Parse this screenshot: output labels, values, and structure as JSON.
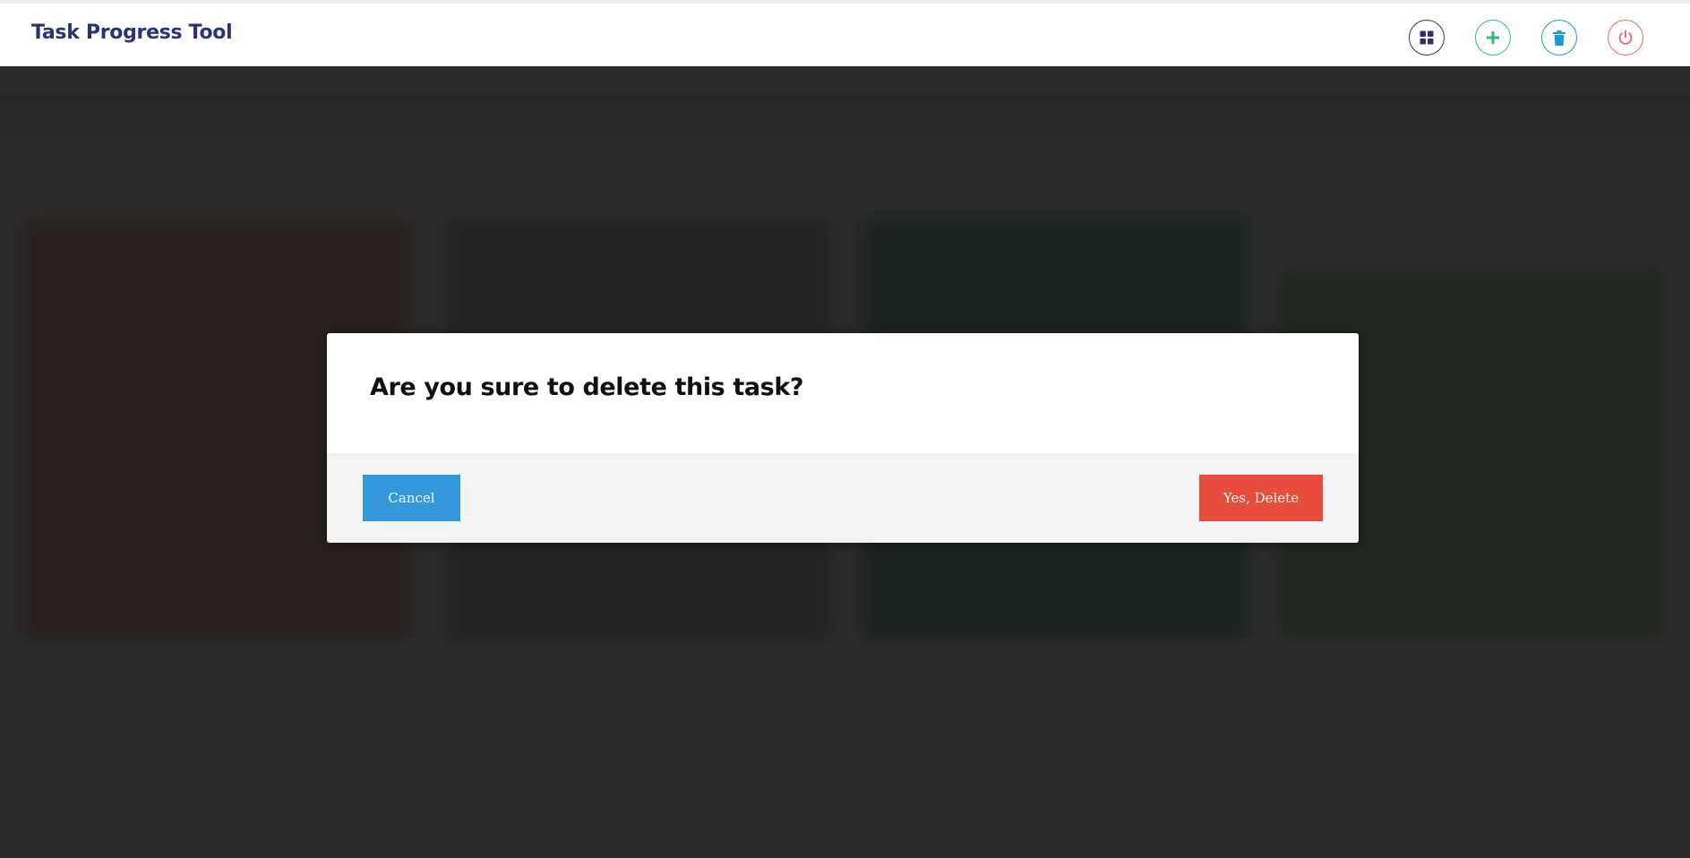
{
  "header": {
    "title": "Task Progress Tool",
    "buttons": {
      "dashboard_icon": "dashboard-grid-icon",
      "add_icon": "plus-icon",
      "trash_icon": "trash-icon",
      "power_icon": "power-icon"
    }
  },
  "modal": {
    "title": "Are you sure to delete this task?",
    "cancel_label": "Cancel",
    "confirm_label": "Yes, Delete"
  },
  "colors": {
    "brand": "#2c3373",
    "add": "#2ebd7d",
    "trash": "#1a9bd7",
    "power": "#e8686a",
    "cancel": "#3398dc",
    "delete": "#e84c3d"
  }
}
